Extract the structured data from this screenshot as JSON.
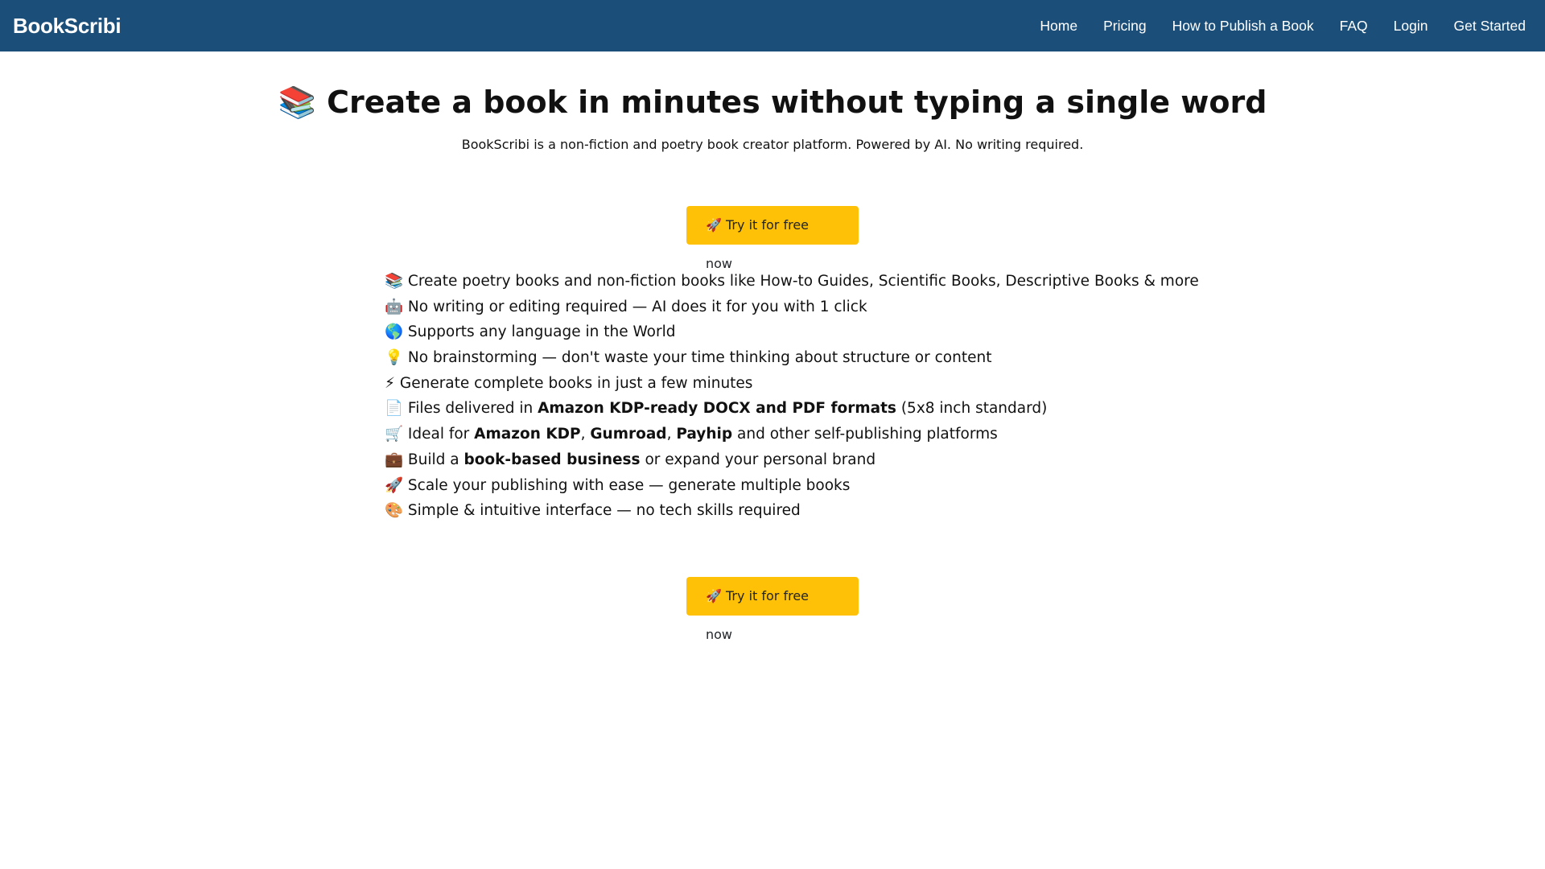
{
  "brand": "BookScribi",
  "nav": {
    "home": "Home",
    "pricing": "Pricing",
    "how_to": "How to Publish a Book",
    "faq": "FAQ",
    "login": "Login",
    "get_started": "Get Started"
  },
  "hero": {
    "title": "📚 Create a book in minutes without typing a single word",
    "subtitle": "BookScribi is a non-fiction and poetry book creator platform. Powered by AI. No writing required."
  },
  "cta": {
    "top_label": "🚀 Try it for free now",
    "bottom_label": "🚀 Try it for free now"
  },
  "features": {
    "f1": "📚 Create poetry books and non-fiction books like How-to Guides, Scientific Books, Descriptive Books & more",
    "f2": "🤖 No writing or editing required — AI does it for you with 1 click",
    "f3": "🌎 Supports any language in the World",
    "f4": "💡 No brainstorming — don't waste your time thinking about structure or content",
    "f5": "⚡ Generate complete books in just a few minutes",
    "f6": {
      "pre": "📄 Files delivered in ",
      "bold": "Amazon KDP-ready DOCX and PDF formats",
      "post": " (5x8 inch standard)"
    },
    "f7": {
      "pre": "🛒 Ideal for ",
      "b1": "Amazon KDP",
      "sep1": ", ",
      "b2": "Gumroad",
      "sep2": ", ",
      "b3": "Payhip",
      "post": " and other self-publishing platforms"
    },
    "f8": {
      "pre": "💼 Build a ",
      "bold": "book-based business",
      "post": " or expand your personal brand"
    },
    "f9": "🚀 Scale your publishing with ease — generate multiple books",
    "f10": "🎨 Simple & intuitive interface — no tech skills required"
  },
  "colors": {
    "navbar_bg": "#1b4f7a",
    "cta_bg": "#ffc107"
  }
}
